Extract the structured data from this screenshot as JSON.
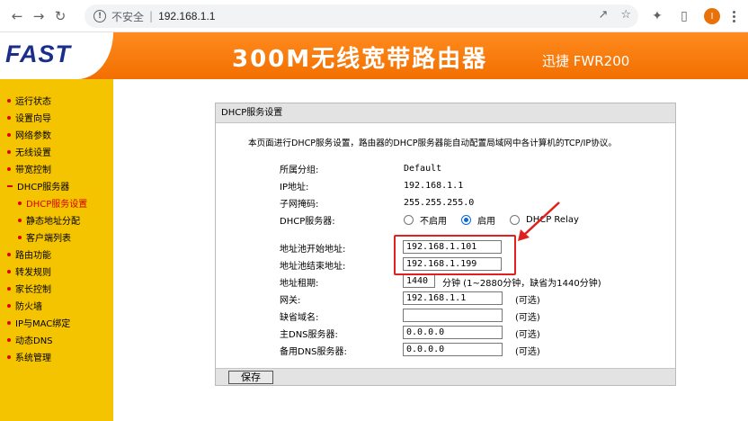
{
  "browser": {
    "insecure_label": "不安全",
    "separator": "|",
    "url": "192.168.1.1",
    "avatar_letter": "I"
  },
  "header": {
    "logo": "FAST",
    "title": "300M无线宽带路由器",
    "model": "迅捷 FWR200"
  },
  "sidebar": {
    "items": [
      {
        "label": "运行状态"
      },
      {
        "label": "设置向导"
      },
      {
        "label": "网络参数"
      },
      {
        "label": "无线设置"
      },
      {
        "label": "带宽控制"
      },
      {
        "label": "DHCP服务器"
      },
      {
        "label": "DHCP服务设置"
      },
      {
        "label": "静态地址分配"
      },
      {
        "label": "客户端列表"
      },
      {
        "label": "路由功能"
      },
      {
        "label": "转发规则"
      },
      {
        "label": "家长控制"
      },
      {
        "label": "防火墙"
      },
      {
        "label": "IP与MAC绑定"
      },
      {
        "label": "动态DNS"
      },
      {
        "label": "系统管理"
      }
    ]
  },
  "panel": {
    "title": "DHCP服务设置",
    "intro": "本页面进行DHCP服务设置，路由器的DHCP服务器能自动配置局域网中各计算机的TCP/IP协议。",
    "group_label": "所属分组:",
    "group_value": "Default",
    "ip_label": "IP地址:",
    "ip_value": "192.168.1.1",
    "mask_label": "子网掩码:",
    "mask_value": "255.255.255.0",
    "dhcp_label": "DHCP服务器:",
    "dhcp_options": [
      "不启用",
      "启用",
      "DHCP Relay"
    ],
    "dhcp_selected": "启用",
    "pool_start_label": "地址池开始地址:",
    "pool_start_value": "192.168.1.101",
    "pool_end_label": "地址池结束地址:",
    "pool_end_value": "192.168.1.199",
    "lease_label": "地址租期:",
    "lease_value": "1440",
    "lease_note": "分钟 (1~2880分钟，缺省为1440分钟)",
    "gateway_label": "网关:",
    "gateway_value": "192.168.1.1",
    "domain_label": "缺省域名:",
    "domain_value": "",
    "dns1_label": "主DNS服务器:",
    "dns1_value": "0.0.0.0",
    "dns2_label": "备用DNS服务器:",
    "dns2_value": "0.0.0.0",
    "optional_label": "(可选)",
    "save_label": "保存"
  },
  "annotation": {
    "highlight_color": "#e0201e"
  }
}
